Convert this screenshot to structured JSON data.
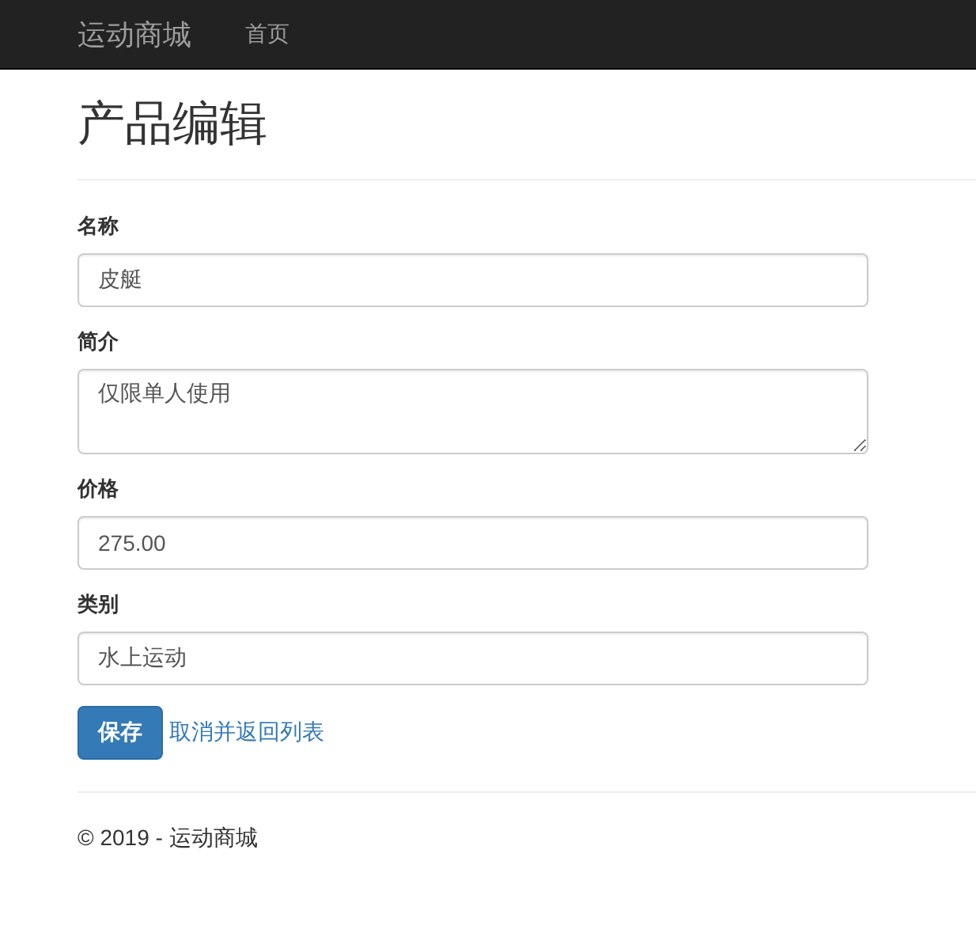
{
  "navbar": {
    "brand": "运动商城",
    "links": [
      "首页"
    ]
  },
  "page": {
    "title": "产品编辑"
  },
  "form": {
    "fields": [
      {
        "label": "名称",
        "kind": "input",
        "value": "皮艇"
      },
      {
        "label": "简介",
        "kind": "textarea",
        "value": "仅限单人使用"
      },
      {
        "label": "价格",
        "kind": "input",
        "value": "275.00"
      },
      {
        "label": "类别",
        "kind": "input",
        "value": "水上运动"
      }
    ],
    "submit": "保存",
    "cancel": "取消并返回列表"
  },
  "footer": {
    "text": "© 2019 - 运动商城"
  }
}
